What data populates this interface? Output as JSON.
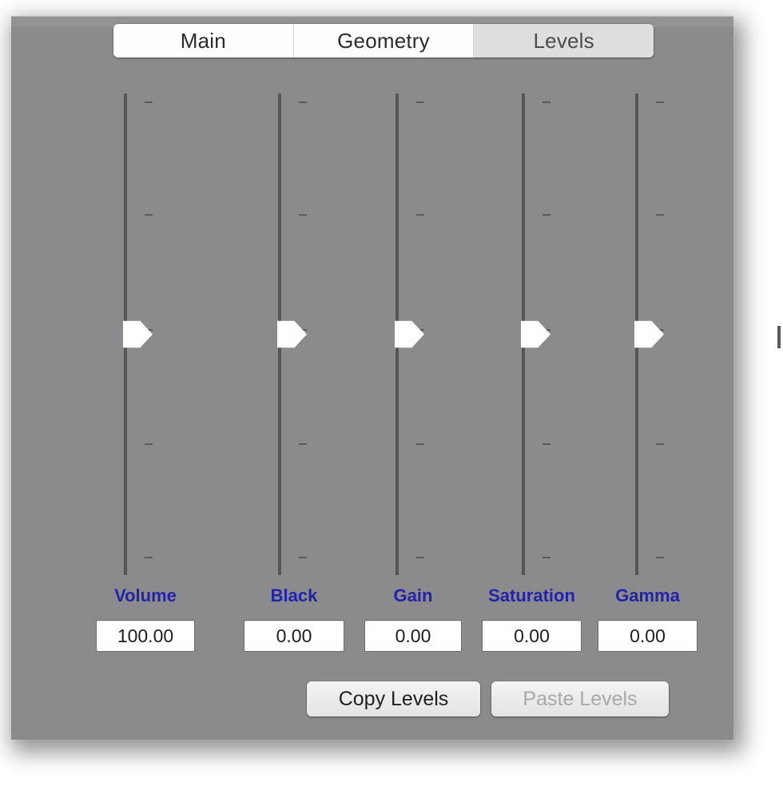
{
  "panel": {
    "background_color": "#8b8a8d",
    "accent_label_color": "#2323a8"
  },
  "tabbar": {
    "tabs": [
      {
        "label": "Main",
        "selected": false
      },
      {
        "label": "Geometry",
        "selected": false
      },
      {
        "label": "Levels",
        "selected": true
      }
    ]
  },
  "sliders": [
    {
      "name": "volume",
      "label": "Volume",
      "value": "100.00",
      "placeholder": "0.00",
      "thumb_position_pct": 50,
      "tick_count": 5
    },
    {
      "name": "black",
      "label": "Black",
      "value": "0.00",
      "placeholder": "0.00",
      "thumb_position_pct": 50,
      "tick_count": 5
    },
    {
      "name": "gain",
      "label": "Gain",
      "value": "0.00",
      "placeholder": "0.00",
      "thumb_position_pct": 50,
      "tick_count": 5
    },
    {
      "name": "saturation",
      "label": "Saturation",
      "value": "0.00",
      "placeholder": "0.00",
      "thumb_position_pct": 50,
      "tick_count": 5
    },
    {
      "name": "gamma",
      "label": "Gamma",
      "value": "0.00",
      "placeholder": "0.00",
      "thumb_position_pct": 50,
      "tick_count": 5
    }
  ],
  "buttons": {
    "copy_levels": {
      "label": "Copy Levels",
      "enabled": true
    },
    "paste_levels": {
      "label": "Paste Levels",
      "enabled": false
    }
  }
}
